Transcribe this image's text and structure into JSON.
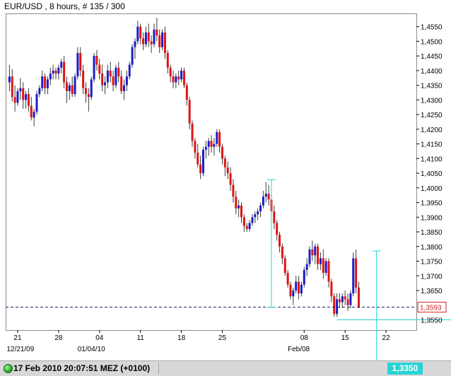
{
  "header": {
    "title": "EUR/USD , 8 hours, # 135 / 300"
  },
  "status": {
    "datetime": "17 Feb 2010 20:07:51  MEZ (+0100)"
  },
  "cursor": {
    "price_label": "1,3350",
    "price": 1.335
  },
  "colors": {
    "up": "#1c1cc8",
    "down": "#e01414",
    "wick": "#3c3c3c",
    "crosshair": "#29d3d6",
    "current_price": "#cc2222",
    "status_ok": "#1b9a1b"
  },
  "chart_data": {
    "type": "candlestick",
    "title": "EUR/USD , 8 hours, # 135 / 300",
    "xlabel": "",
    "ylabel": "",
    "ylim": [
      1.3515,
      1.4595
    ],
    "y_ticks": [
      "1,4550",
      "1,4500",
      "1,4450",
      "1,4400",
      "1,4350",
      "1,4300",
      "1,4250",
      "1,4200",
      "1,4150",
      "1,4100",
      "1,4050",
      "1,4000",
      "1,3950",
      "1,3900",
      "1,3850",
      "1,3800",
      "1,3750",
      "1,3700",
      "1,3650",
      "1,3550"
    ],
    "x_ticks": [
      {
        "label": "21",
        "bar": 3
      },
      {
        "label": "28",
        "bar": 18
      },
      {
        "label": "04",
        "bar": 33
      },
      {
        "label": "11",
        "bar": 48
      },
      {
        "label": "18",
        "bar": 63
      },
      {
        "label": "25",
        "bar": 78
      },
      {
        "label": "08",
        "bar": 108
      },
      {
        "label": "15",
        "bar": 123
      },
      {
        "label": "22",
        "bar": 138
      }
    ],
    "date_labels": [
      {
        "label": "12/21/09",
        "bar": 4
      },
      {
        "label": "01/04/10",
        "bar": 30
      },
      {
        "label": "Feb/08",
        "bar": 106
      }
    ],
    "current_price": {
      "value": 1.3593,
      "label": "1,3593"
    },
    "measure": {
      "from": 1.3593,
      "to": 1.4028,
      "bar": 96
    },
    "crosshair": {
      "price": 1.335,
      "bar": 134,
      "level": 1.355
    },
    "cursor_marker": {
      "bar": 134,
      "value": 1.3785
    },
    "ohlc": [
      [
        1.436,
        1.442,
        1.433,
        1.438
      ],
      [
        1.438,
        1.4405,
        1.4295,
        1.431
      ],
      [
        1.431,
        1.435,
        1.426,
        1.429
      ],
      [
        1.429,
        1.434,
        1.428,
        1.433
      ],
      [
        1.433,
        1.4375,
        1.43,
        1.434
      ],
      [
        1.434,
        1.436,
        1.427,
        1.43
      ],
      [
        1.43,
        1.433,
        1.427,
        1.432
      ],
      [
        1.432,
        1.434,
        1.426,
        1.428
      ],
      [
        1.428,
        1.431,
        1.423,
        1.424
      ],
      [
        1.424,
        1.427,
        1.421,
        1.426
      ],
      [
        1.426,
        1.433,
        1.425,
        1.432
      ],
      [
        1.432,
        1.435,
        1.431,
        1.434
      ],
      [
        1.434,
        1.44,
        1.433,
        1.438
      ],
      [
        1.438,
        1.439,
        1.432,
        1.434
      ],
      [
        1.434,
        1.438,
        1.432,
        1.437
      ],
      [
        1.437,
        1.441,
        1.435,
        1.439
      ],
      [
        1.439,
        1.442,
        1.437,
        1.44
      ],
      [
        1.44,
        1.441,
        1.437,
        1.439
      ],
      [
        1.439,
        1.442,
        1.437,
        1.441
      ],
      [
        1.441,
        1.444,
        1.439,
        1.443
      ],
      [
        1.443,
        1.445,
        1.434,
        1.436
      ],
      [
        1.436,
        1.438,
        1.429,
        1.433
      ],
      [
        1.433,
        1.436,
        1.43,
        1.435
      ],
      [
        1.435,
        1.438,
        1.431,
        1.432
      ],
      [
        1.432,
        1.439,
        1.431,
        1.438
      ],
      [
        1.438,
        1.448,
        1.437,
        1.446
      ],
      [
        1.446,
        1.448,
        1.438,
        1.44
      ],
      [
        1.44,
        1.442,
        1.432,
        1.434
      ],
      [
        1.434,
        1.436,
        1.429,
        1.432
      ],
      [
        1.432,
        1.434,
        1.426,
        1.431
      ],
      [
        1.431,
        1.438,
        1.43,
        1.437
      ],
      [
        1.437,
        1.446,
        1.436,
        1.445
      ],
      [
        1.445,
        1.447,
        1.44,
        1.442
      ],
      [
        1.442,
        1.444,
        1.437,
        1.439
      ],
      [
        1.439,
        1.442,
        1.433,
        1.435
      ],
      [
        1.435,
        1.438,
        1.432,
        1.436
      ],
      [
        1.436,
        1.442,
        1.434,
        1.44
      ],
      [
        1.44,
        1.443,
        1.436,
        1.438
      ],
      [
        1.438,
        1.44,
        1.433,
        1.435
      ],
      [
        1.435,
        1.442,
        1.434,
        1.441
      ],
      [
        1.441,
        1.443,
        1.436,
        1.438
      ],
      [
        1.438,
        1.44,
        1.432,
        1.433
      ],
      [
        1.433,
        1.437,
        1.43,
        1.435
      ],
      [
        1.435,
        1.44,
        1.433,
        1.438
      ],
      [
        1.438,
        1.443,
        1.437,
        1.442
      ],
      [
        1.442,
        1.449,
        1.441,
        1.448
      ],
      [
        1.448,
        1.451,
        1.444,
        1.45
      ],
      [
        1.45,
        1.457,
        1.449,
        1.455
      ],
      [
        1.455,
        1.456,
        1.449,
        1.451
      ],
      [
        1.451,
        1.453,
        1.447,
        1.449
      ],
      [
        1.449,
        1.455,
        1.448,
        1.453
      ],
      [
        1.453,
        1.456,
        1.448,
        1.45
      ],
      [
        1.45,
        1.452,
        1.446,
        1.449
      ],
      [
        1.449,
        1.456,
        1.448,
        1.454
      ],
      [
        1.454,
        1.458,
        1.45,
        1.452
      ],
      [
        1.452,
        1.454,
        1.446,
        1.448
      ],
      [
        1.448,
        1.454,
        1.447,
        1.453
      ],
      [
        1.453,
        1.455,
        1.444,
        1.446
      ],
      [
        1.446,
        1.447,
        1.439,
        1.441
      ],
      [
        1.441,
        1.442,
        1.436,
        1.438
      ],
      [
        1.438,
        1.44,
        1.434,
        1.436
      ],
      [
        1.436,
        1.439,
        1.434,
        1.438
      ],
      [
        1.438,
        1.44,
        1.435,
        1.437
      ],
      [
        1.437,
        1.441,
        1.436,
        1.44
      ],
      [
        1.44,
        1.441,
        1.434,
        1.435
      ],
      [
        1.435,
        1.436,
        1.428,
        1.43
      ],
      [
        1.43,
        1.431,
        1.42,
        1.422
      ],
      [
        1.422,
        1.423,
        1.414,
        1.416
      ],
      [
        1.416,
        1.417,
        1.41,
        1.412
      ],
      [
        1.412,
        1.415,
        1.407,
        1.408
      ],
      [
        1.408,
        1.411,
        1.403,
        1.405
      ],
      [
        1.405,
        1.414,
        1.404,
        1.413
      ],
      [
        1.413,
        1.416,
        1.41,
        1.414
      ],
      [
        1.414,
        1.417,
        1.411,
        1.416
      ],
      [
        1.416,
        1.418,
        1.412,
        1.414
      ],
      [
        1.414,
        1.417,
        1.411,
        1.415
      ],
      [
        1.415,
        1.42,
        1.414,
        1.419
      ],
      [
        1.419,
        1.42,
        1.412,
        1.414
      ],
      [
        1.414,
        1.415,
        1.408,
        1.41
      ],
      [
        1.41,
        1.411,
        1.404,
        1.407
      ],
      [
        1.407,
        1.409,
        1.403,
        1.405
      ],
      [
        1.405,
        1.407,
        1.399,
        1.401
      ],
      [
        1.401,
        1.403,
        1.395,
        1.397
      ],
      [
        1.397,
        1.399,
        1.391,
        1.393
      ],
      [
        1.393,
        1.396,
        1.39,
        1.394
      ],
      [
        1.394,
        1.395,
        1.388,
        1.39
      ],
      [
        1.39,
        1.391,
        1.385,
        1.387
      ],
      [
        1.387,
        1.388,
        1.385,
        1.386
      ],
      [
        1.386,
        1.389,
        1.385,
        1.388
      ],
      [
        1.388,
        1.391,
        1.387,
        1.39
      ],
      [
        1.39,
        1.392,
        1.388,
        1.391
      ],
      [
        1.391,
        1.393,
        1.389,
        1.392
      ],
      [
        1.392,
        1.395,
        1.39,
        1.394
      ],
      [
        1.394,
        1.399,
        1.393,
        1.397
      ],
      [
        1.397,
        1.402,
        1.395,
        1.398
      ],
      [
        1.398,
        1.401,
        1.394,
        1.396
      ],
      [
        1.396,
        1.398,
        1.39,
        1.392
      ],
      [
        1.392,
        1.394,
        1.386,
        1.388
      ],
      [
        1.388,
        1.389,
        1.382,
        1.384
      ],
      [
        1.384,
        1.385,
        1.378,
        1.38
      ],
      [
        1.38,
        1.381,
        1.374,
        1.376
      ],
      [
        1.376,
        1.377,
        1.37,
        1.371
      ],
      [
        1.371,
        1.372,
        1.366,
        1.367
      ],
      [
        1.367,
        1.368,
        1.362,
        1.363
      ],
      [
        1.363,
        1.366,
        1.36,
        1.365
      ],
      [
        1.365,
        1.37,
        1.364,
        1.368
      ],
      [
        1.368,
        1.37,
        1.362,
        1.364
      ],
      [
        1.364,
        1.368,
        1.363,
        1.367
      ],
      [
        1.367,
        1.373,
        1.366,
        1.372
      ],
      [
        1.372,
        1.376,
        1.37,
        1.374
      ],
      [
        1.374,
        1.38,
        1.373,
        1.379
      ],
      [
        1.379,
        1.382,
        1.375,
        1.377
      ],
      [
        1.377,
        1.381,
        1.374,
        1.38
      ],
      [
        1.38,
        1.381,
        1.372,
        1.374
      ],
      [
        1.374,
        1.378,
        1.372,
        1.376
      ],
      [
        1.376,
        1.379,
        1.369,
        1.371
      ],
      [
        1.371,
        1.376,
        1.37,
        1.375
      ],
      [
        1.375,
        1.376,
        1.366,
        1.368
      ],
      [
        1.368,
        1.369,
        1.361,
        1.363
      ],
      [
        1.363,
        1.364,
        1.356,
        1.357
      ],
      [
        1.357,
        1.364,
        1.356,
        1.362
      ],
      [
        1.362,
        1.364,
        1.359,
        1.361
      ],
      [
        1.361,
        1.364,
        1.359,
        1.363
      ],
      [
        1.363,
        1.365,
        1.36,
        1.362
      ],
      [
        1.362,
        1.364,
        1.358,
        1.36
      ],
      [
        1.36,
        1.365,
        1.359,
        1.364
      ],
      [
        1.364,
        1.378,
        1.363,
        1.376
      ],
      [
        1.376,
        1.379,
        1.364,
        1.366
      ],
      [
        1.366,
        1.368,
        1.359,
        1.3593
      ]
    ]
  }
}
